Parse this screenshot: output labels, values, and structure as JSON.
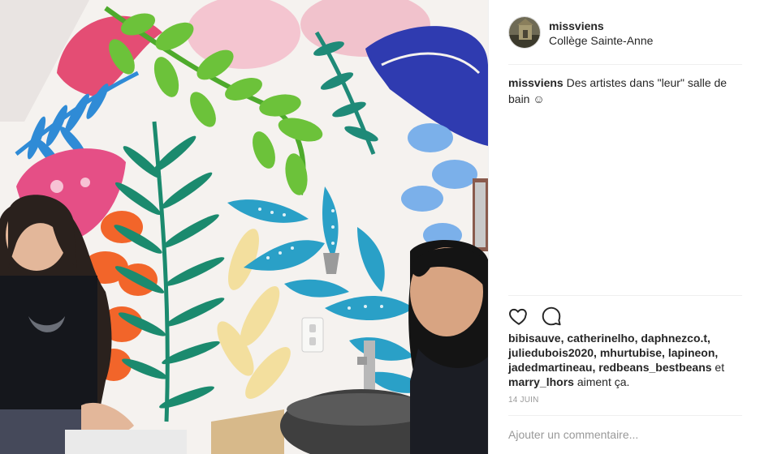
{
  "post": {
    "author": {
      "username": "missviens",
      "location": "Collège Sainte-Anne"
    },
    "caption": {
      "username": "missviens",
      "text": "Des artistes dans \"leur\" salle de bain ☺"
    },
    "likes": {
      "likers": "bibisauve, catherinelho, daphnezco.t, juliedubois2020, mhurtubise, lapineon, jadedmartineau, redbeans_bestbeans",
      "connector": " et ",
      "last": "marry_lhors",
      "suffix": " aiment ça."
    },
    "date": "14 JUIN",
    "comment": {
      "placeholder": "Ajouter un commentaire..."
    }
  },
  "icons": {
    "like": "heart-icon",
    "comment": "comment-icon"
  },
  "colors": {
    "text": "#262626",
    "muted": "#999999",
    "border": "#efefef"
  }
}
